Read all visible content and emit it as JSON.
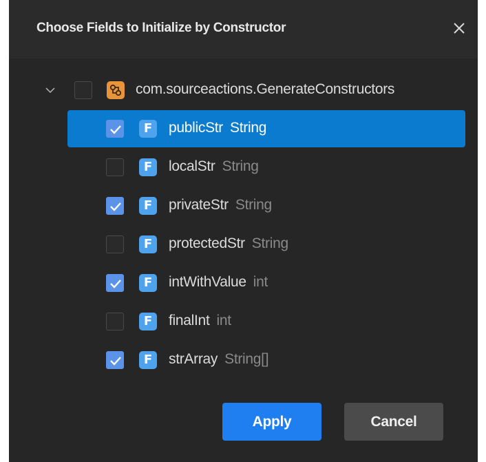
{
  "dialog": {
    "title": "Choose Fields to Initialize by Constructor",
    "close_icon": "close-icon"
  },
  "tree": {
    "root": {
      "label": "com.sourceactions.GenerateConstructors",
      "icon": "class-icon",
      "expanded": true,
      "checked": false
    },
    "fields": [
      {
        "name": "publicStr",
        "type": "String",
        "checked": true,
        "selected": true,
        "icon_letter": "F"
      },
      {
        "name": "localStr",
        "type": "String",
        "checked": false,
        "selected": false,
        "icon_letter": "F"
      },
      {
        "name": "privateStr",
        "type": "String",
        "checked": true,
        "selected": false,
        "icon_letter": "F"
      },
      {
        "name": "protectedStr",
        "type": "String",
        "checked": false,
        "selected": false,
        "icon_letter": "F"
      },
      {
        "name": "intWithValue",
        "type": "int",
        "checked": true,
        "selected": false,
        "icon_letter": "F"
      },
      {
        "name": "finalInt",
        "type": "int",
        "checked": false,
        "selected": false,
        "icon_letter": "F"
      },
      {
        "name": "strArray",
        "type": "String[]",
        "checked": true,
        "selected": false,
        "icon_letter": "F"
      }
    ]
  },
  "buttons": {
    "apply_label": "Apply",
    "cancel_label": "Cancel"
  },
  "colors": {
    "dialog_bg": "#262626",
    "selection": "#0b7bd0",
    "checkbox_checked": "#5a93e8",
    "field_icon": "#4fa3ed",
    "class_icon": "#e8943a",
    "apply_button": "#1f7ff0"
  }
}
